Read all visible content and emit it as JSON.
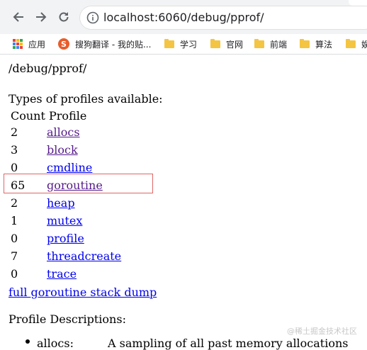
{
  "browser": {
    "url_host": "localhost",
    "url_rest": ":6060/debug/pprof/",
    "bookmarks": [
      {
        "label": "应用",
        "icon": "apps-grid-icon"
      },
      {
        "label": "搜狗翻译 - 我的贴...",
        "icon": "sogou-icon"
      },
      {
        "label": "学习",
        "icon": "folder-icon"
      },
      {
        "label": "官网",
        "icon": "folder-icon"
      },
      {
        "label": "前端",
        "icon": "folder-icon"
      },
      {
        "label": "算法",
        "icon": "folder-icon"
      },
      {
        "label": "娱",
        "icon": "folder-icon"
      }
    ]
  },
  "page": {
    "path": "/debug/pprof/",
    "types_heading": "Types of profiles available:",
    "col_count": "Count",
    "col_profile": "Profile",
    "profiles": [
      {
        "count": "2",
        "name": "allocs",
        "visited": true
      },
      {
        "count": "3",
        "name": "block",
        "visited": true
      },
      {
        "count": "0",
        "name": "cmdline",
        "visited": false
      },
      {
        "count": "65",
        "name": "goroutine",
        "visited": true,
        "highlighted": true
      },
      {
        "count": "2",
        "name": "heap",
        "visited": false
      },
      {
        "count": "1",
        "name": "mutex",
        "visited": false
      },
      {
        "count": "0",
        "name": "profile",
        "visited": false
      },
      {
        "count": "7",
        "name": "threadcreate",
        "visited": false
      },
      {
        "count": "0",
        "name": "trace",
        "visited": false
      }
    ],
    "full_dump_link": "full goroutine stack dump",
    "descriptions_heading": "Profile Descriptions:",
    "descriptions": [
      {
        "name": "allocs:",
        "text": "A sampling of all past memory allocations"
      }
    ],
    "watermark": "@稀土掘金技术社区"
  },
  "colors": {
    "link": "#0000ee",
    "visited_link": "#551a8b",
    "highlight_border": "#e06666"
  }
}
